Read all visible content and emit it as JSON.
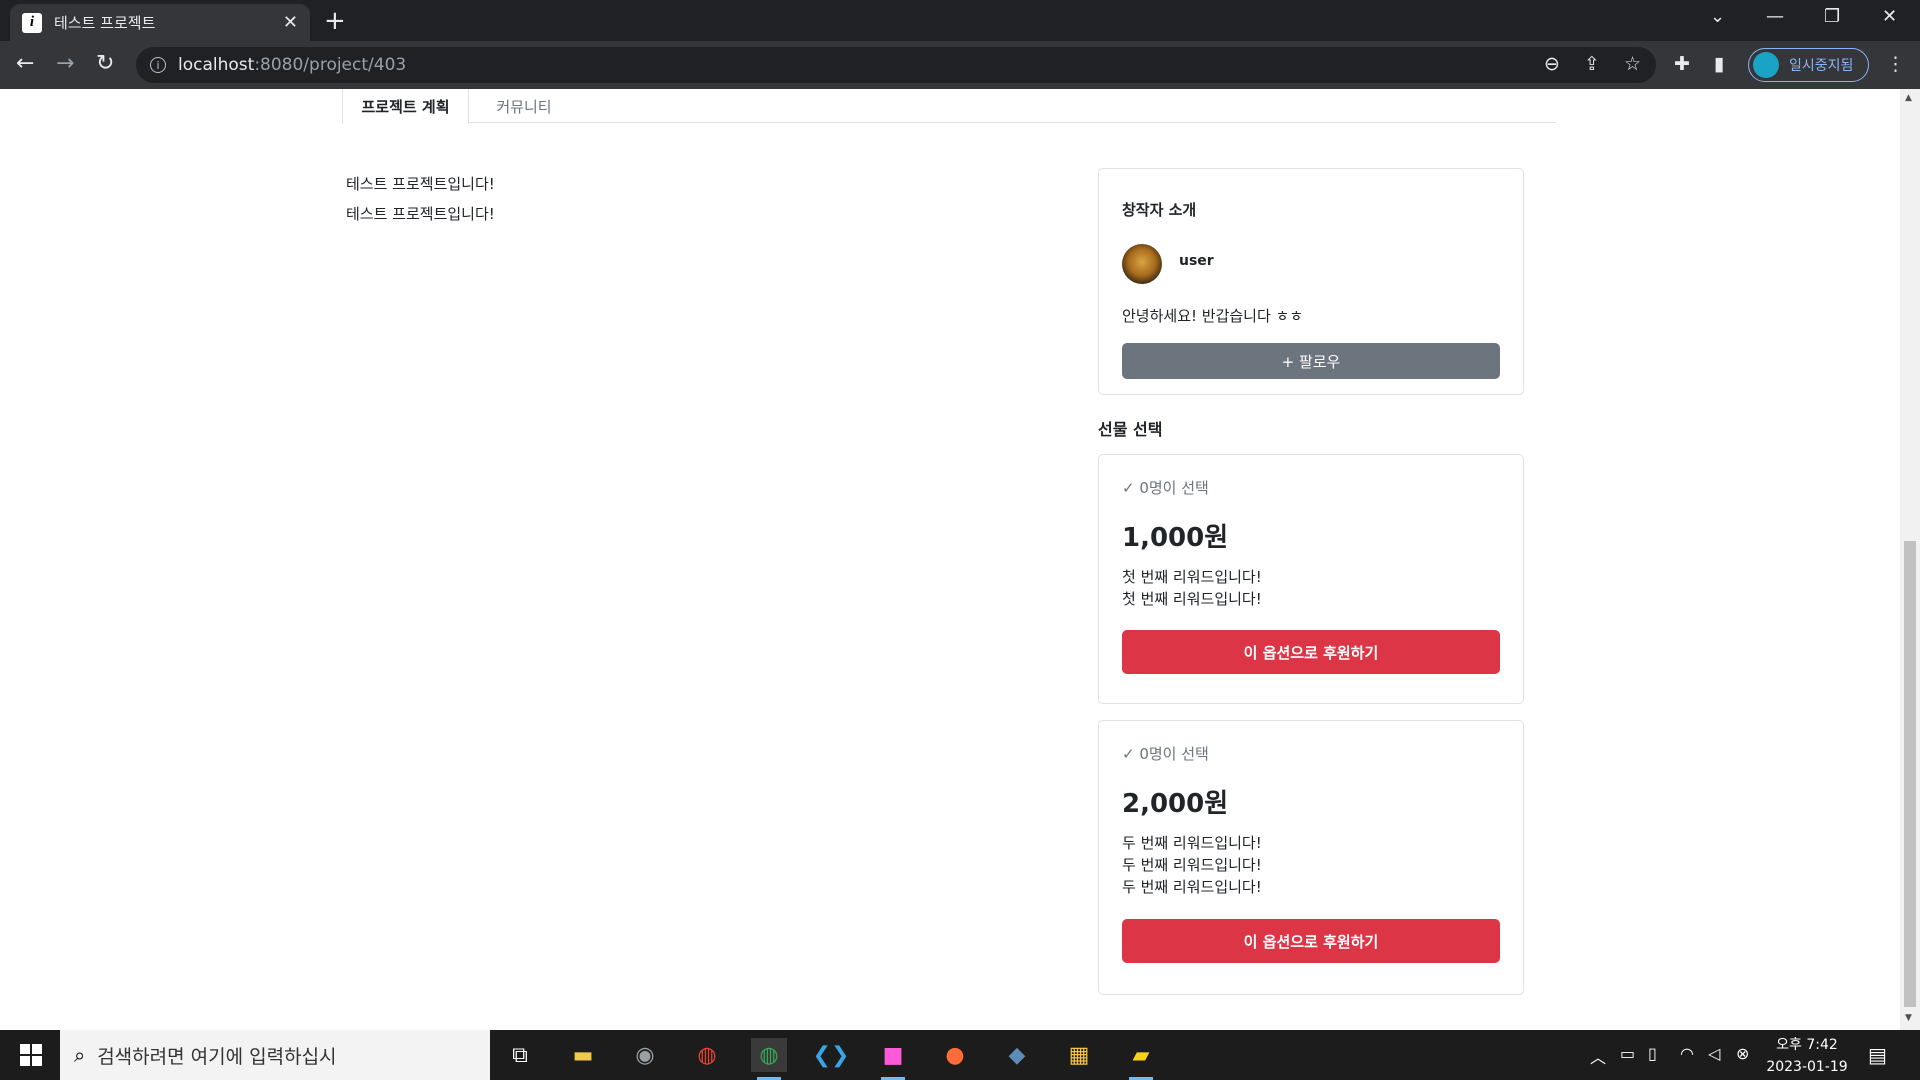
{
  "browser": {
    "tab_title": "테스트 프로젝트",
    "tab_favicon": "i",
    "url_host": "localhost",
    "url_path": ":8080/project/403",
    "profile_label": "일시중지됨",
    "colors": {
      "frame": "#202124",
      "toolbar": "#35363a",
      "profile_accent": "#8ab4f8"
    }
  },
  "project": {
    "tabs": [
      "프로젝트 계획",
      "커뮤니티"
    ],
    "description": [
      "테스트 프로젝트입니다!",
      "테스트 프로젝트입니다!"
    ]
  },
  "creator": {
    "heading": "창작자 소개",
    "username": "user",
    "intro": "안녕하세요! 반갑습니다 ㅎㅎ",
    "follow_label": "+ 팔로우"
  },
  "gifts": {
    "heading": "선물 선택",
    "rewards": [
      {
        "selected": "✓ 0명이 선택",
        "price": "1,000원",
        "lines": [
          "첫 번째 리워드입니다!",
          "첫 번째 리워드입니다!"
        ],
        "button": "이 옵션으로 후원하기"
      },
      {
        "selected": "✓ 0명이 선택",
        "price": "2,000원",
        "lines": [
          "두 번째 리워드입니다!",
          "두 번째 리워드입니다!",
          "두 번째 리워드입니다!"
        ],
        "button": "이 옵션으로 후원하기"
      }
    ],
    "colors": {
      "back_button": "#dc3545",
      "follow_button": "#6c757d"
    }
  },
  "taskbar": {
    "search_placeholder": "검색하려면 여기에 입력하십시",
    "time": "오후 7:42",
    "date": "2023-01-19"
  }
}
